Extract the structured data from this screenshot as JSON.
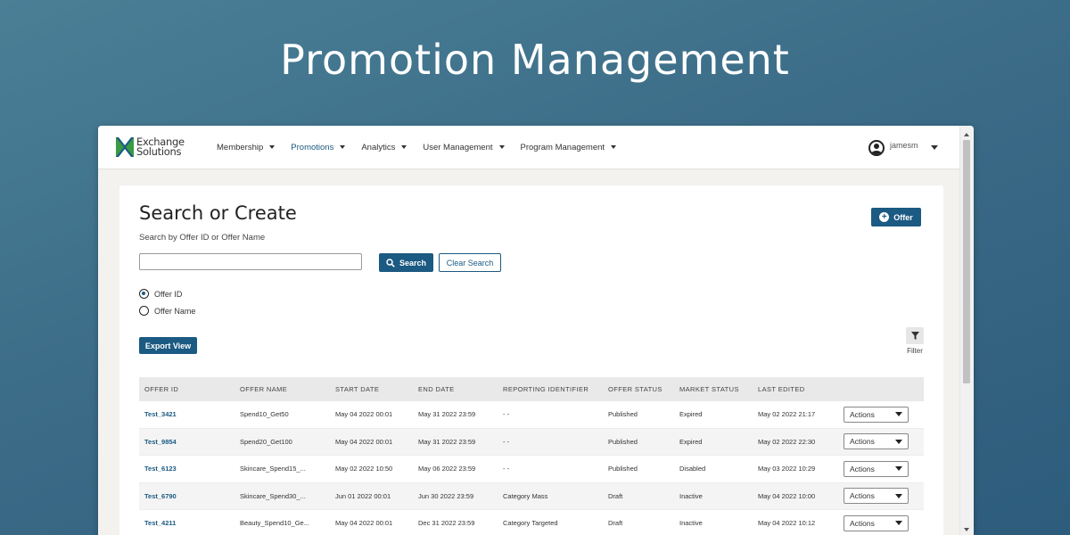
{
  "hero": {
    "title": "Promotion Management"
  },
  "nav": {
    "logo_line1": "Exchange",
    "logo_line2": "Solutions",
    "items": [
      {
        "label": "Membership",
        "active": false
      },
      {
        "label": "Promotions",
        "active": true
      },
      {
        "label": "Analytics",
        "active": false
      },
      {
        "label": "User Management",
        "active": false
      },
      {
        "label": "Program Management",
        "active": false
      }
    ],
    "user": "jamesm"
  },
  "page": {
    "title": "Search or Create",
    "subtitle": "Search by Offer ID or Offer Name",
    "offer_button": "Offer",
    "search_value": "",
    "search_button": "Search",
    "clear_button": "Clear Search",
    "radio_options": [
      {
        "label": "Offer ID",
        "checked": true
      },
      {
        "label": "Offer Name",
        "checked": false
      }
    ],
    "export_button": "Export View",
    "filter_label": "Filter"
  },
  "table": {
    "headers": [
      "OFFER ID",
      "OFFER NAME",
      "START DATE",
      "END DATE",
      "REPORTING IDENTIFIER",
      "OFFER STATUS",
      "MARKET STATUS",
      "LAST EDITED"
    ],
    "actions_label": "Actions",
    "rows": [
      [
        "Test_3421",
        "Spend10_Get50",
        "May 04 2022 00:01",
        "May 31 2022 23:59",
        "- -",
        "Published",
        "Expired",
        "May 02 2022 21:17"
      ],
      [
        "Test_9854",
        "Spend20_Get100",
        "May 04 2022 00:01",
        "May 31 2022 23:59",
        "- -",
        "Published",
        "Expired",
        "May 02 2022 22:30"
      ],
      [
        "Test_6123",
        "Skincare_Spend15_...",
        "May 02 2022 10:50",
        "May 06 2022 23:59",
        "- -",
        "Published",
        "Disabled",
        "May 03 2022 10:29"
      ],
      [
        "Test_6790",
        "Skincare_Spend30_...",
        "Jun 01 2022 00:01",
        "Jun 30 2022 23:59",
        "Category Mass",
        "Draft",
        "Inactive",
        "May 04 2022 10:00"
      ],
      [
        "Test_4211",
        "Beauty_Spend10_Ge...",
        "May 04 2022 00:01",
        "Dec 31 2022 23:59",
        "Category Targeted",
        "Draft",
        "Inactive",
        "May 04 2022 10:12"
      ]
    ]
  },
  "colors": {
    "brand": "#1b5a82",
    "background": "#3a6a86",
    "logo_green": "#3a9a45"
  }
}
